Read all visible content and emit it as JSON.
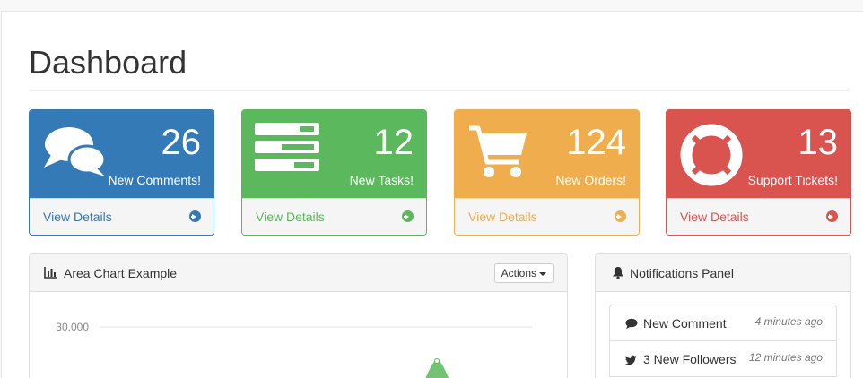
{
  "page": {
    "title": "Dashboard"
  },
  "cards": [
    {
      "count": "26",
      "label": "New Comments!",
      "link": "View Details",
      "icon": "comments-icon",
      "color": "#337ab7"
    },
    {
      "count": "12",
      "label": "New Tasks!",
      "link": "View Details",
      "icon": "tasks-icon",
      "color": "#5cb85c"
    },
    {
      "count": "124",
      "label": "New Orders!",
      "link": "View Details",
      "icon": "shopping-cart-icon",
      "color": "#f0ad4e"
    },
    {
      "count": "13",
      "label": "Support Tickets!",
      "link": "View Details",
      "icon": "life-ring-icon",
      "color": "#d9534f"
    }
  ],
  "area_chart": {
    "title": "Area Chart Example",
    "icon": "bar-chart-icon",
    "actions_label": "Actions"
  },
  "chart_data": {
    "type": "area",
    "title": "",
    "xlabel": "",
    "ylabel": "",
    "y_ticks": [
      "30,000"
    ],
    "grid": true,
    "series_color": "#5cb85c"
  },
  "notifications": {
    "title": "Notifications Panel",
    "icon": "bell-icon",
    "items": [
      {
        "icon": "comment-icon",
        "text": "New Comment",
        "time": "4 minutes ago"
      },
      {
        "icon": "twitter-icon",
        "text": "3 New Followers",
        "time": "12 minutes ago"
      }
    ]
  }
}
